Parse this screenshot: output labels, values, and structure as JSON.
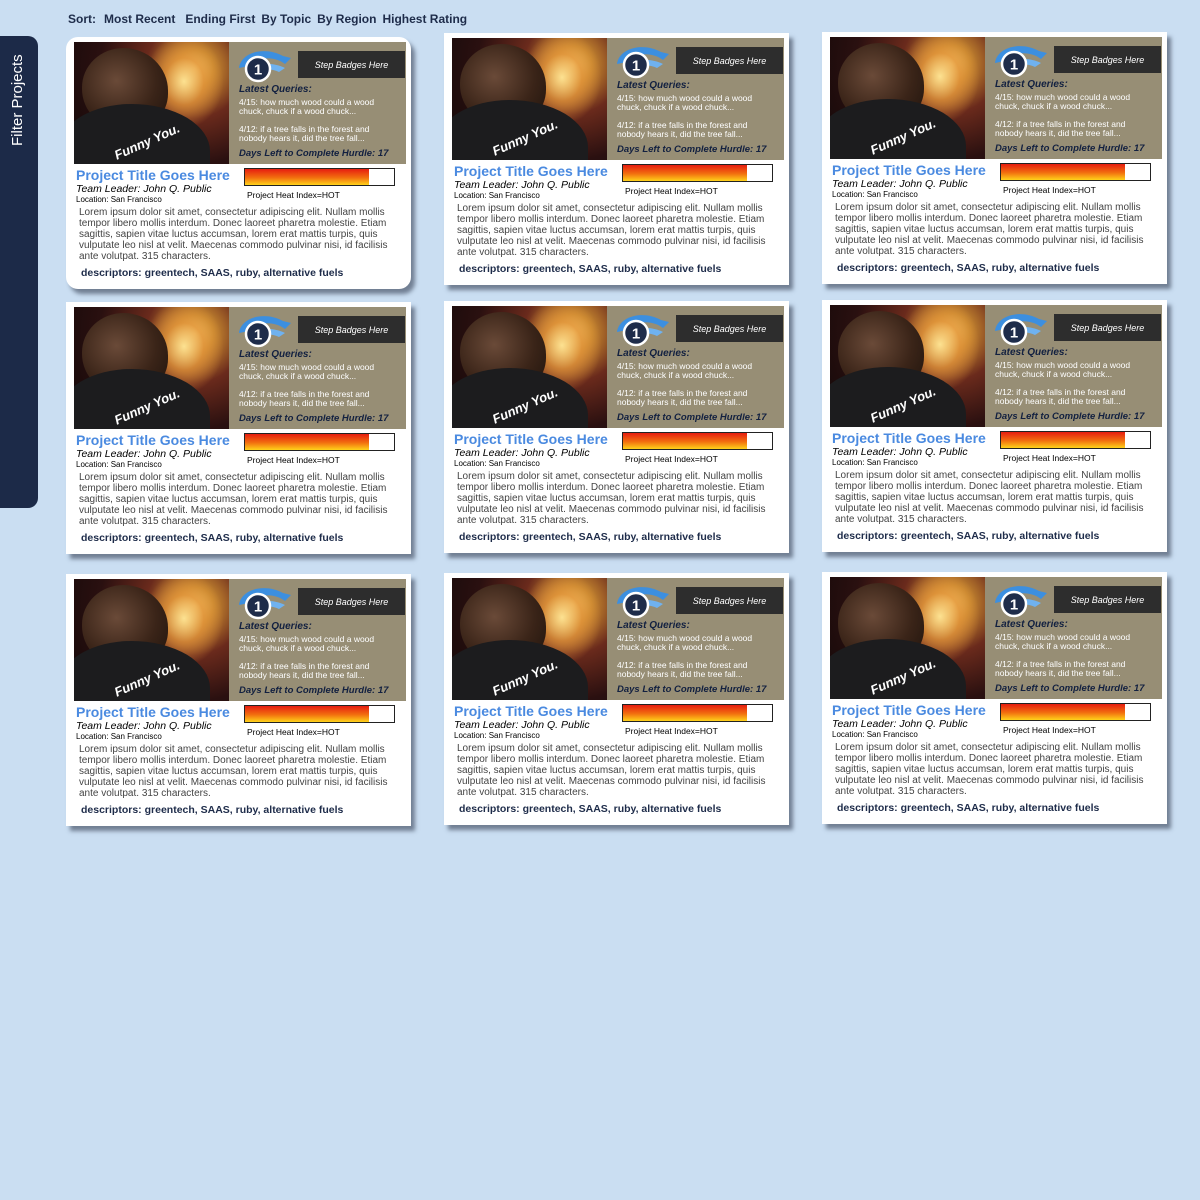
{
  "sort": {
    "label": "Sort:",
    "options": [
      "Most Recent",
      "Ending First",
      "By Topic",
      "By Region",
      "Highest Rating"
    ]
  },
  "sidebar": {
    "filter_label": "Filter Projects"
  },
  "colors": {
    "background": "#cadef2",
    "panel": "#978e75",
    "title_accent": "#4a8ae0",
    "sidebar": "#1c2a48"
  },
  "cards": [
    {
      "photo_caption": "Funny You.",
      "badge_number": "1",
      "step_badges": "Step Badges Here",
      "queries_title": "Latest Queries:",
      "query1": "4/15: how much wood could a wood chuck, chuck if a wood chuck...",
      "query2": "4/12: if a tree falls in the forest and nobody hears it, did the tree fall...",
      "days_left": "Days Left to Complete Hurdle: 17",
      "title": "Project Title Goes Here",
      "team_leader": "Team Leader: John Q. Public",
      "location": "Location: San Francisco",
      "heat_label": "Project Heat Index=HOT",
      "heat_level": 0.83,
      "description": "Lorem ipsum dolor sit amet, consectetur adipiscing elit. Nullam mollis tempor libero mollis interdum. Donec laoreet pharetra molestie. Etiam sagittis, sapien vitae luctus accumsan, lorem erat mattis turpis, quis vulputate leo nisl at velit. Maecenas commodo pulvinar nisi, id facilisis ante volutpat. 315 characters.",
      "descriptors": "descriptors:  greentech, SAAS, ruby, alternative fuels"
    },
    {
      "photo_caption": "Funny You.",
      "badge_number": "1",
      "step_badges": "Step Badges Here",
      "queries_title": "Latest Queries:",
      "query1": "4/15: how much wood could a wood chuck, chuck if a wood chuck...",
      "query2": "4/12: if a tree falls in the forest and nobody hears it, did the tree fall...",
      "days_left": "Days Left to Complete Hurdle: 17",
      "title": "Project Title Goes Here",
      "team_leader": "Team Leader: John Q. Public",
      "location": "Location: San Francisco",
      "heat_label": "Project Heat Index=HOT",
      "heat_level": 0.83,
      "description": "Lorem ipsum dolor sit amet, consectetur adipiscing elit. Nullam mollis tempor libero mollis interdum. Donec laoreet pharetra molestie. Etiam sagittis, sapien vitae luctus accumsan, lorem erat mattis turpis, quis vulputate leo nisl at velit. Maecenas commodo pulvinar nisi, id facilisis ante volutpat. 315 characters.",
      "descriptors": "descriptors:  greentech, SAAS, ruby, alternative fuels"
    },
    {
      "photo_caption": "Funny You.",
      "badge_number": "1",
      "step_badges": "Step Badges Here",
      "queries_title": "Latest Queries:",
      "query1": "4/15: how much wood could a wood chuck, chuck if a wood chuck...",
      "query2": "4/12: if a tree falls in the forest and nobody hears it, did the tree fall...",
      "days_left": "Days Left to Complete Hurdle: 17",
      "title": "Project Title Goes Here",
      "team_leader": "Team Leader: John Q. Public",
      "location": "Location: San Francisco",
      "heat_label": "Project Heat Index=HOT",
      "heat_level": 0.83,
      "description": "Lorem ipsum dolor sit amet, consectetur adipiscing elit. Nullam mollis tempor libero mollis interdum. Donec laoreet pharetra molestie. Etiam sagittis, sapien vitae luctus accumsan, lorem erat mattis turpis, quis vulputate leo nisl at velit. Maecenas commodo pulvinar nisi, id facilisis ante volutpat. 315 characters.",
      "descriptors": "descriptors:  greentech, SAAS, ruby, alternative fuels"
    },
    {
      "photo_caption": "Funny You.",
      "badge_number": "1",
      "step_badges": "Step Badges Here",
      "queries_title": "Latest Queries:",
      "query1": "4/15: how much wood could a wood chuck, chuck if a wood chuck...",
      "query2": "4/12: if a tree falls in the forest and nobody hears it, did the tree fall...",
      "days_left": "Days Left to Complete Hurdle: 17",
      "title": "Project Title Goes Here",
      "team_leader": "Team Leader: John Q. Public",
      "location": "Location: San Francisco",
      "heat_label": "Project Heat Index=HOT",
      "heat_level": 0.83,
      "description": "Lorem ipsum dolor sit amet, consectetur adipiscing elit. Nullam mollis tempor libero mollis interdum. Donec laoreet pharetra molestie. Etiam sagittis, sapien vitae luctus accumsan, lorem erat mattis turpis, quis vulputate leo nisl at velit. Maecenas commodo pulvinar nisi, id facilisis ante volutpat. 315 characters.",
      "descriptors": "descriptors:  greentech, SAAS, ruby, alternative fuels"
    },
    {
      "photo_caption": "Funny You.",
      "badge_number": "1",
      "step_badges": "Step Badges Here",
      "queries_title": "Latest Queries:",
      "query1": "4/15: how much wood could a wood chuck, chuck if a wood chuck...",
      "query2": "4/12: if a tree falls in the forest and nobody hears it, did the tree fall...",
      "days_left": "Days Left to Complete Hurdle: 17",
      "title": "Project Title Goes Here",
      "team_leader": "Team Leader: John Q. Public",
      "location": "Location: San Francisco",
      "heat_label": "Project Heat Index=HOT",
      "heat_level": 0.83,
      "description": "Lorem ipsum dolor sit amet, consectetur adipiscing elit. Nullam mollis tempor libero mollis interdum. Donec laoreet pharetra molestie. Etiam sagittis, sapien vitae luctus accumsan, lorem erat mattis turpis, quis vulputate leo nisl at velit. Maecenas commodo pulvinar nisi, id facilisis ante volutpat. 315 characters.",
      "descriptors": "descriptors:  greentech, SAAS, ruby, alternative fuels"
    },
    {
      "photo_caption": "Funny You.",
      "badge_number": "1",
      "step_badges": "Step Badges Here",
      "queries_title": "Latest Queries:",
      "query1": "4/15: how much wood could a wood chuck, chuck if a wood chuck...",
      "query2": "4/12: if a tree falls in the forest and nobody hears it, did the tree fall...",
      "days_left": "Days Left to Complete Hurdle: 17",
      "title": "Project Title Goes Here",
      "team_leader": "Team Leader: John Q. Public",
      "location": "Location: San Francisco",
      "heat_label": "Project Heat Index=HOT",
      "heat_level": 0.83,
      "description": "Lorem ipsum dolor sit amet, consectetur adipiscing elit. Nullam mollis tempor libero mollis interdum. Donec laoreet pharetra molestie. Etiam sagittis, sapien vitae luctus accumsan, lorem erat mattis turpis, quis vulputate leo nisl at velit. Maecenas commodo pulvinar nisi, id facilisis ante volutpat. 315 characters.",
      "descriptors": "descriptors:  greentech, SAAS, ruby, alternative fuels"
    },
    {
      "photo_caption": "Funny You.",
      "badge_number": "1",
      "step_badges": "Step Badges Here",
      "queries_title": "Latest Queries:",
      "query1": "4/15: how much wood could a wood chuck, chuck if a wood chuck...",
      "query2": "4/12: if a tree falls in the forest and nobody hears it, did the tree fall...",
      "days_left": "Days Left to Complete Hurdle: 17",
      "title": "Project Title Goes Here",
      "team_leader": "Team Leader: John Q. Public",
      "location": "Location: San Francisco",
      "heat_label": "Project Heat Index=HOT",
      "heat_level": 0.83,
      "description": "Lorem ipsum dolor sit amet, consectetur adipiscing elit. Nullam mollis tempor libero mollis interdum. Donec laoreet pharetra molestie. Etiam sagittis, sapien vitae luctus accumsan, lorem erat mattis turpis, quis vulputate leo nisl at velit. Maecenas commodo pulvinar nisi, id facilisis ante volutpat. 315 characters.",
      "descriptors": "descriptors:  greentech, SAAS, ruby, alternative fuels"
    },
    {
      "photo_caption": "Funny You.",
      "badge_number": "1",
      "step_badges": "Step Badges Here",
      "queries_title": "Latest Queries:",
      "query1": "4/15: how much wood could a wood chuck, chuck if a wood chuck...",
      "query2": "4/12: if a tree falls in the forest and nobody hears it, did the tree fall...",
      "days_left": "Days Left to Complete Hurdle: 17",
      "title": "Project Title Goes Here",
      "team_leader": "Team Leader: John Q. Public",
      "location": "Location: San Francisco",
      "heat_label": "Project Heat Index=HOT",
      "heat_level": 0.83,
      "description": "Lorem ipsum dolor sit amet, consectetur adipiscing elit. Nullam mollis tempor libero mollis interdum. Donec laoreet pharetra molestie. Etiam sagittis, sapien vitae luctus accumsan, lorem erat mattis turpis, quis vulputate leo nisl at velit. Maecenas commodo pulvinar nisi, id facilisis ante volutpat. 315 characters.",
      "descriptors": "descriptors:  greentech, SAAS, ruby, alternative fuels"
    },
    {
      "photo_caption": "Funny You.",
      "badge_number": "1",
      "step_badges": "Step Badges Here",
      "queries_title": "Latest Queries:",
      "query1": "4/15: how much wood could a wood chuck, chuck if a wood chuck...",
      "query2": "4/12: if a tree falls in the forest and nobody hears it, did the tree fall...",
      "days_left": "Days Left to Complete Hurdle: 17",
      "title": "Project Title Goes Here",
      "team_leader": "Team Leader: John Q. Public",
      "location": "Location: San Francisco",
      "heat_label": "Project Heat Index=HOT",
      "heat_level": 0.83,
      "description": "Lorem ipsum dolor sit amet, consectetur adipiscing elit. Nullam mollis tempor libero mollis interdum. Donec laoreet pharetra molestie. Etiam sagittis, sapien vitae luctus accumsan, lorem erat mattis turpis, quis vulputate leo nisl at velit. Maecenas commodo pulvinar nisi, id facilisis ante volutpat. 315 characters.",
      "descriptors": "descriptors:  greentech, SAAS, ruby, alternative fuels"
    }
  ]
}
